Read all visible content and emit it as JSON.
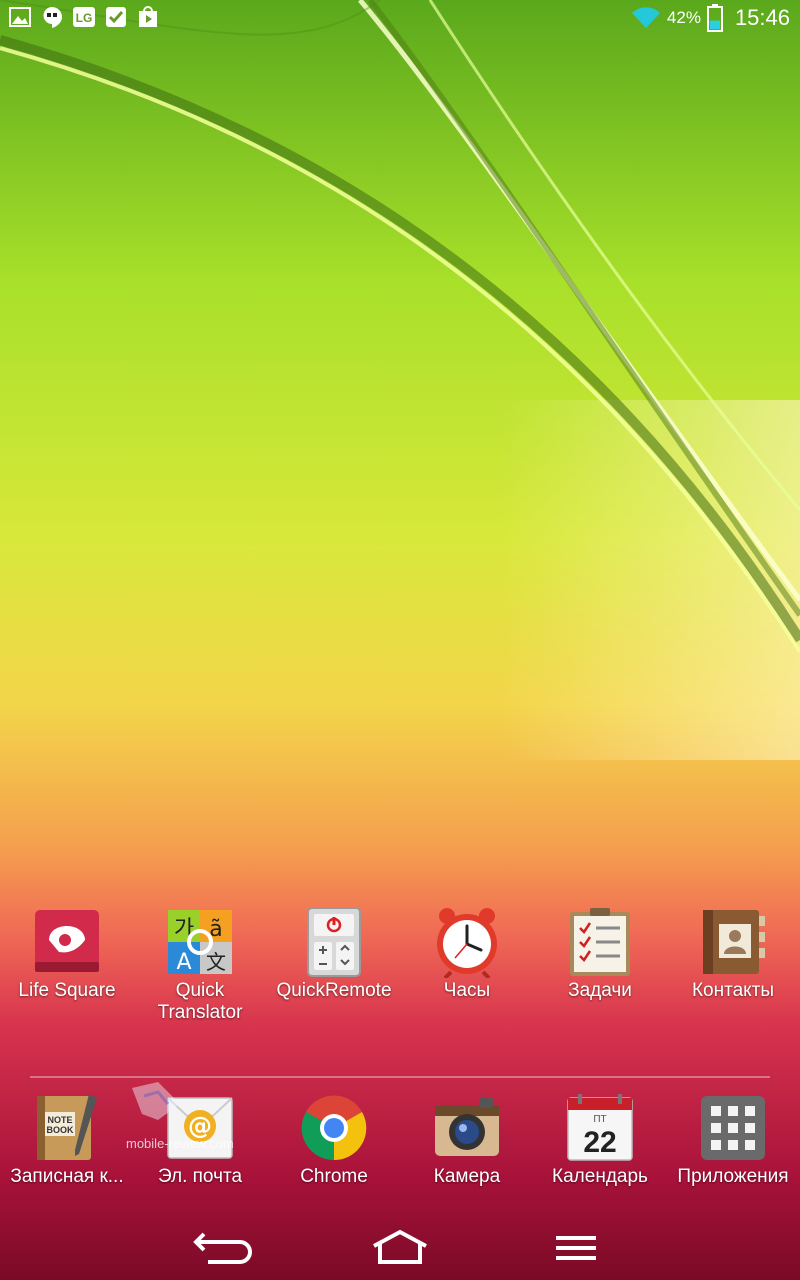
{
  "status_bar": {
    "notification_icons": [
      "gallery-icon",
      "hangouts-icon",
      "lg-icon",
      "tasks-check-icon",
      "play-store-icon"
    ],
    "wifi_icon": "wifi-icon",
    "battery_percent": "42%",
    "battery_level": 0.42,
    "time": "15:46"
  },
  "home_apps": [
    {
      "label": "Life Square",
      "icon": "life-square-icon"
    },
    {
      "label": "Quick\nTranslator",
      "icon": "quick-translator-icon"
    },
    {
      "label": "QuickRemote",
      "icon": "quickremote-icon"
    },
    {
      "label": "Часы",
      "icon": "clock-icon"
    },
    {
      "label": "Задачи",
      "icon": "tasks-icon"
    },
    {
      "label": "Контакты",
      "icon": "contacts-icon"
    }
  ],
  "dock_apps": [
    {
      "label": "Записная к...",
      "icon": "notebook-icon"
    },
    {
      "label": "Эл. почта",
      "icon": "email-icon"
    },
    {
      "label": "Chrome",
      "icon": "chrome-icon"
    },
    {
      "label": "Камера",
      "icon": "camera-icon"
    },
    {
      "label": "Календарь",
      "icon": "calendar-icon",
      "calendar_weekday": "ПТ",
      "calendar_day": "22"
    },
    {
      "label": "Приложения",
      "icon": "apps-grid-icon"
    }
  ],
  "translator_glyphs": {
    "ko": "가",
    "a_tilde": "ã",
    "latin": "A",
    "cjk": "文"
  },
  "notebook_text": {
    "line1": "NOTE",
    "line2": "BOOK"
  },
  "email_glyph": "@",
  "watermark": "mobile-review.com",
  "nav_bar": {
    "back_icon": "back-icon",
    "home_icon": "home-icon",
    "menu_icon": "menu-icon"
  }
}
